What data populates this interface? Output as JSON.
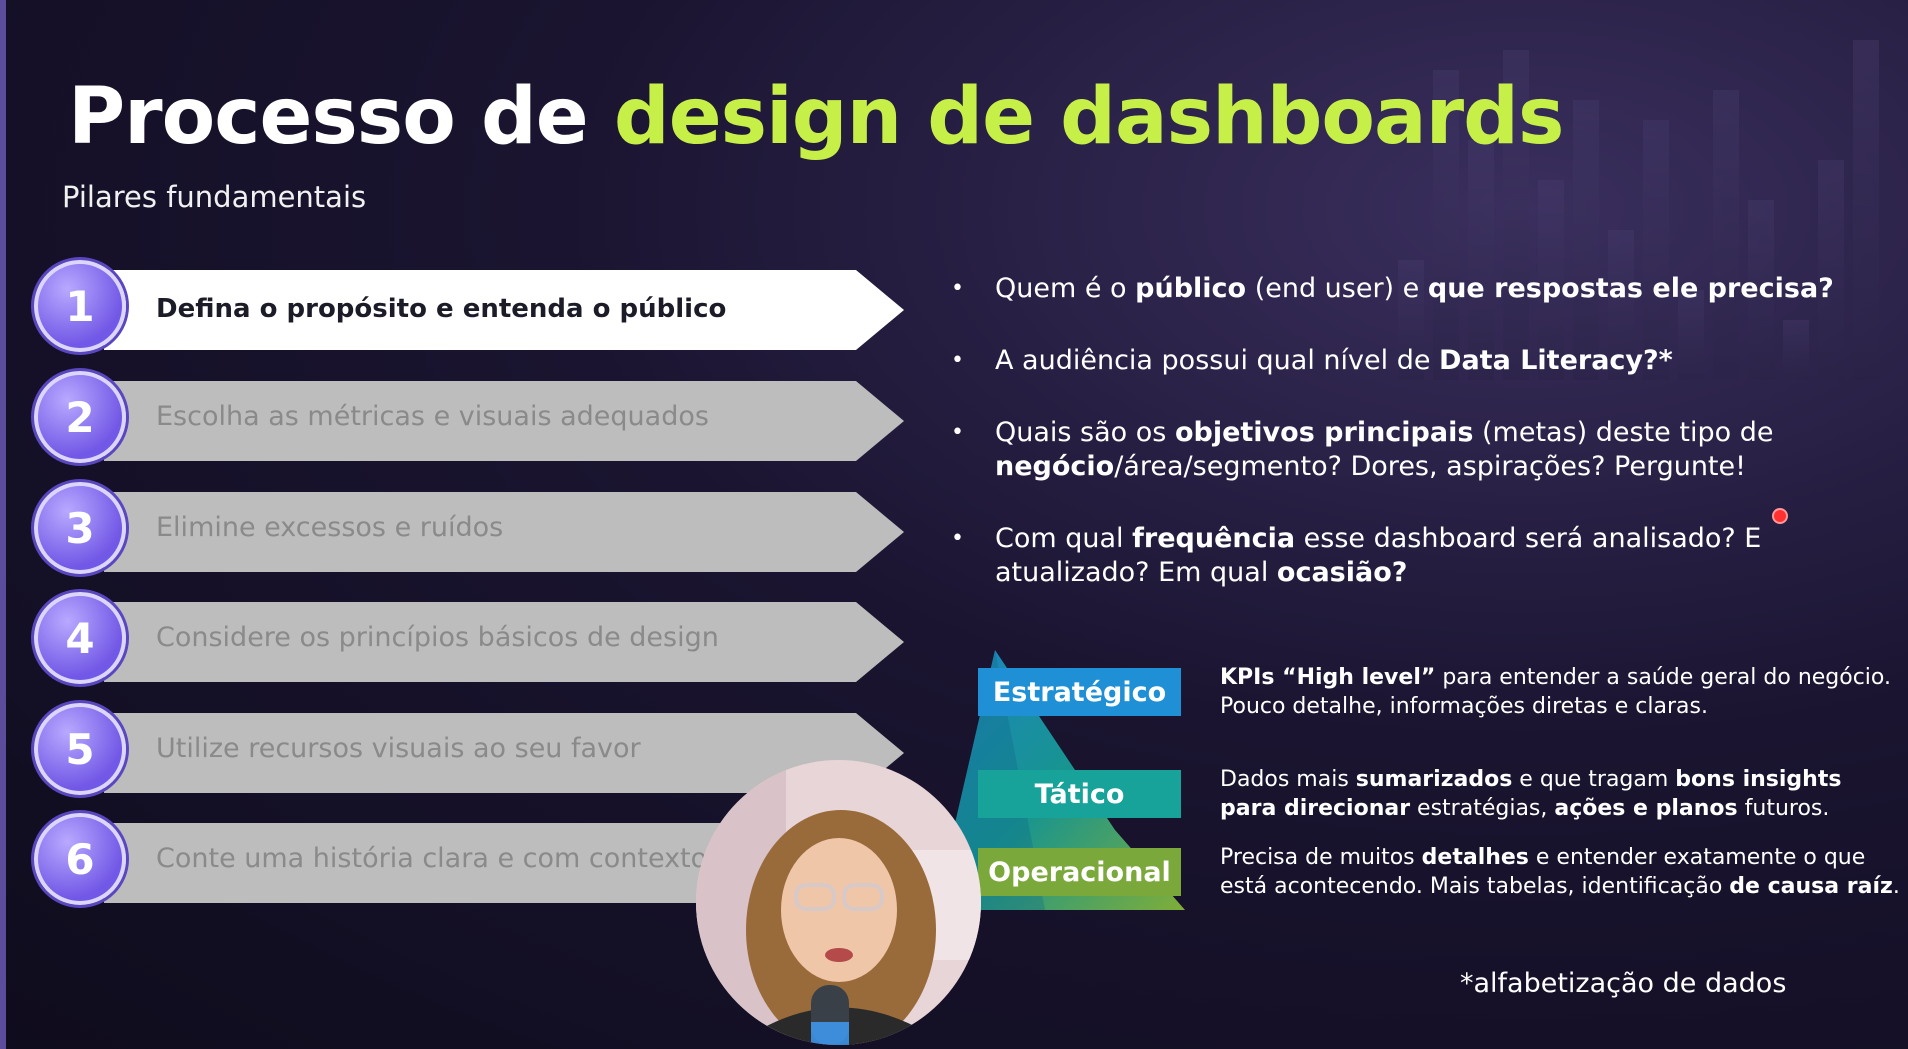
{
  "slide": {
    "title_part1": "Processo de ",
    "title_part2": "design de dashboards",
    "subtitle": "Pilares fundamentais",
    "accent_color": "#c6f048"
  },
  "steps": [
    {
      "number": "1",
      "label": "Defina o propósito e entenda o público",
      "active": true
    },
    {
      "number": "2",
      "label": "Escolha as métricas e visuais adequados",
      "active": false
    },
    {
      "number": "3",
      "label": "Elimine excessos e ruídos",
      "active": false
    },
    {
      "number": "4",
      "label": "Considere os princípios básicos de design",
      "active": false
    },
    {
      "number": "5",
      "label": "Utilize recursos visuais ao seu favor",
      "active": false
    },
    {
      "number": "6",
      "label": "Conte uma história clara e com contexto",
      "active": false
    }
  ],
  "bullets": [
    {
      "t1": "Quem é o ",
      "b1": "público",
      "t2": " (end user) e ",
      "b2": "que respostas ele precisa?",
      "t3": "",
      "b3": "",
      "t4": ""
    },
    {
      "t1": "A audiência possui qual nível de ",
      "b1": "Data Literacy?*",
      "t2": "",
      "b2": "",
      "t3": "",
      "b3": "",
      "t4": ""
    },
    {
      "t1": "Quais são os ",
      "b1": "objetivos principais",
      "t2": " (metas) deste tipo de ",
      "b2": "negócio",
      "t3": "/área/segmento? Dores, aspirações? Pergunte!",
      "b3": "",
      "t4": ""
    },
    {
      "t1": "Com qual ",
      "b1": "frequência",
      "t2": " esse dashboard será analisado? E atualizado? Em qual ",
      "b2": "ocasião?",
      "t3": "",
      "b3": "",
      "t4": ""
    }
  ],
  "pyramid": {
    "levels": [
      {
        "label": "Estratégico",
        "color": "#1f8fd6"
      },
      {
        "label": "Tático",
        "color": "#17a39a"
      },
      {
        "label": "Operacional",
        "color": "#7aa83a"
      }
    ],
    "descriptions": [
      {
        "b1": "KPIs “High level”",
        "t1": " para entender a saúde geral do negócio. Pouco detalhe, informações diretas e claras.",
        "b2": "",
        "t2": "",
        "b3": "",
        "t3": "",
        "b4": "",
        "t4": ""
      },
      {
        "b1": "",
        "t1": "Dados mais ",
        "b2": "sumarizados",
        "t2": " e que tragam ",
        "b3": "bons insights para direcionar",
        "t3": " estratégias, ",
        "b4": "ações e planos",
        "t4": " futuros."
      },
      {
        "b1": "",
        "t1": "Precisa de muitos ",
        "b2": "detalhes",
        "t2": " e entender exatamente o que está acontecendo. Mais tabelas, identificação ",
        "b3": "de causa raíz",
        "t3": ".",
        "b4": "",
        "t4": ""
      }
    ]
  },
  "footnote": "*alfabetização de dados"
}
